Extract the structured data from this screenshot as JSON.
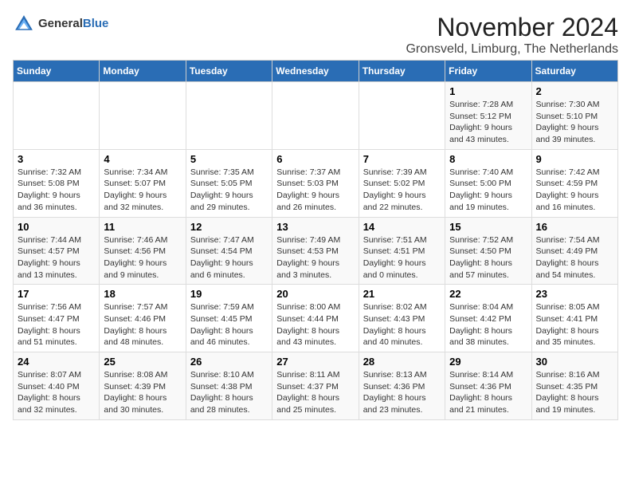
{
  "header": {
    "logo_general": "General",
    "logo_blue": "Blue",
    "month_title": "November 2024",
    "location": "Gronsveld, Limburg, The Netherlands"
  },
  "weekdays": [
    "Sunday",
    "Monday",
    "Tuesday",
    "Wednesday",
    "Thursday",
    "Friday",
    "Saturday"
  ],
  "weeks": [
    [
      {
        "day": "",
        "info": ""
      },
      {
        "day": "",
        "info": ""
      },
      {
        "day": "",
        "info": ""
      },
      {
        "day": "",
        "info": ""
      },
      {
        "day": "",
        "info": ""
      },
      {
        "day": "1",
        "info": "Sunrise: 7:28 AM\nSunset: 5:12 PM\nDaylight: 9 hours\nand 43 minutes."
      },
      {
        "day": "2",
        "info": "Sunrise: 7:30 AM\nSunset: 5:10 PM\nDaylight: 9 hours\nand 39 minutes."
      }
    ],
    [
      {
        "day": "3",
        "info": "Sunrise: 7:32 AM\nSunset: 5:08 PM\nDaylight: 9 hours\nand 36 minutes."
      },
      {
        "day": "4",
        "info": "Sunrise: 7:34 AM\nSunset: 5:07 PM\nDaylight: 9 hours\nand 32 minutes."
      },
      {
        "day": "5",
        "info": "Sunrise: 7:35 AM\nSunset: 5:05 PM\nDaylight: 9 hours\nand 29 minutes."
      },
      {
        "day": "6",
        "info": "Sunrise: 7:37 AM\nSunset: 5:03 PM\nDaylight: 9 hours\nand 26 minutes."
      },
      {
        "day": "7",
        "info": "Sunrise: 7:39 AM\nSunset: 5:02 PM\nDaylight: 9 hours\nand 22 minutes."
      },
      {
        "day": "8",
        "info": "Sunrise: 7:40 AM\nSunset: 5:00 PM\nDaylight: 9 hours\nand 19 minutes."
      },
      {
        "day": "9",
        "info": "Sunrise: 7:42 AM\nSunset: 4:59 PM\nDaylight: 9 hours\nand 16 minutes."
      }
    ],
    [
      {
        "day": "10",
        "info": "Sunrise: 7:44 AM\nSunset: 4:57 PM\nDaylight: 9 hours\nand 13 minutes."
      },
      {
        "day": "11",
        "info": "Sunrise: 7:46 AM\nSunset: 4:56 PM\nDaylight: 9 hours\nand 9 minutes."
      },
      {
        "day": "12",
        "info": "Sunrise: 7:47 AM\nSunset: 4:54 PM\nDaylight: 9 hours\nand 6 minutes."
      },
      {
        "day": "13",
        "info": "Sunrise: 7:49 AM\nSunset: 4:53 PM\nDaylight: 9 hours\nand 3 minutes."
      },
      {
        "day": "14",
        "info": "Sunrise: 7:51 AM\nSunset: 4:51 PM\nDaylight: 9 hours\nand 0 minutes."
      },
      {
        "day": "15",
        "info": "Sunrise: 7:52 AM\nSunset: 4:50 PM\nDaylight: 8 hours\nand 57 minutes."
      },
      {
        "day": "16",
        "info": "Sunrise: 7:54 AM\nSunset: 4:49 PM\nDaylight: 8 hours\nand 54 minutes."
      }
    ],
    [
      {
        "day": "17",
        "info": "Sunrise: 7:56 AM\nSunset: 4:47 PM\nDaylight: 8 hours\nand 51 minutes."
      },
      {
        "day": "18",
        "info": "Sunrise: 7:57 AM\nSunset: 4:46 PM\nDaylight: 8 hours\nand 48 minutes."
      },
      {
        "day": "19",
        "info": "Sunrise: 7:59 AM\nSunset: 4:45 PM\nDaylight: 8 hours\nand 46 minutes."
      },
      {
        "day": "20",
        "info": "Sunrise: 8:00 AM\nSunset: 4:44 PM\nDaylight: 8 hours\nand 43 minutes."
      },
      {
        "day": "21",
        "info": "Sunrise: 8:02 AM\nSunset: 4:43 PM\nDaylight: 8 hours\nand 40 minutes."
      },
      {
        "day": "22",
        "info": "Sunrise: 8:04 AM\nSunset: 4:42 PM\nDaylight: 8 hours\nand 38 minutes."
      },
      {
        "day": "23",
        "info": "Sunrise: 8:05 AM\nSunset: 4:41 PM\nDaylight: 8 hours\nand 35 minutes."
      }
    ],
    [
      {
        "day": "24",
        "info": "Sunrise: 8:07 AM\nSunset: 4:40 PM\nDaylight: 8 hours\nand 32 minutes."
      },
      {
        "day": "25",
        "info": "Sunrise: 8:08 AM\nSunset: 4:39 PM\nDaylight: 8 hours\nand 30 minutes."
      },
      {
        "day": "26",
        "info": "Sunrise: 8:10 AM\nSunset: 4:38 PM\nDaylight: 8 hours\nand 28 minutes."
      },
      {
        "day": "27",
        "info": "Sunrise: 8:11 AM\nSunset: 4:37 PM\nDaylight: 8 hours\nand 25 minutes."
      },
      {
        "day": "28",
        "info": "Sunrise: 8:13 AM\nSunset: 4:36 PM\nDaylight: 8 hours\nand 23 minutes."
      },
      {
        "day": "29",
        "info": "Sunrise: 8:14 AM\nSunset: 4:36 PM\nDaylight: 8 hours\nand 21 minutes."
      },
      {
        "day": "30",
        "info": "Sunrise: 8:16 AM\nSunset: 4:35 PM\nDaylight: 8 hours\nand 19 minutes."
      }
    ]
  ]
}
